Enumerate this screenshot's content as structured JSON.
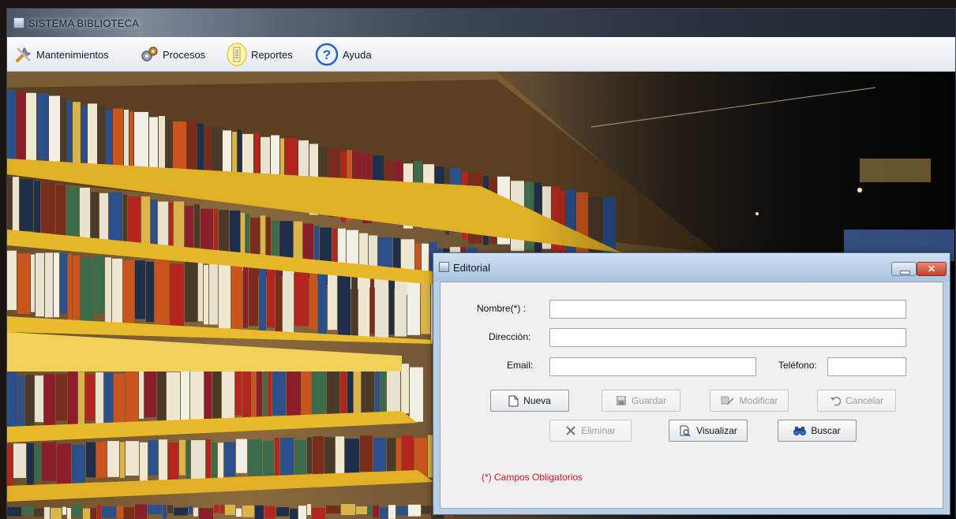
{
  "window": {
    "title": "SISTEMA BIBLIOTECA"
  },
  "menubar": {
    "items": [
      {
        "label": "Mantenimientos",
        "icon": "wrench-icon"
      },
      {
        "label": "Procesos",
        "icon": "gears-icon"
      },
      {
        "label": "Reportes",
        "icon": "report-icon"
      },
      {
        "label": "Ayuda",
        "icon": "help-icon"
      }
    ]
  },
  "dialog": {
    "title": "Editorial",
    "fields": {
      "nombre": {
        "label": "Nombre(*) :",
        "value": ""
      },
      "direccion": {
        "label": "Direcciòn:",
        "value": ""
      },
      "email": {
        "label": "Email:",
        "value": ""
      },
      "telefono": {
        "label": "Teléfono:",
        "value": ""
      }
    },
    "buttons": {
      "nueva": {
        "label": "Nueva",
        "enabled": true
      },
      "guardar": {
        "label": "Guardar",
        "enabled": false
      },
      "modificar": {
        "label": "Modificar",
        "enabled": false
      },
      "cancelar": {
        "label": "Cancelar",
        "enabled": false
      },
      "eliminar": {
        "label": "Eliminar",
        "enabled": false
      },
      "visualizar": {
        "label": "Visualizar",
        "enabled": true
      },
      "buscar": {
        "label": "Buscar",
        "enabled": true
      }
    },
    "required_note": "(*) Campos Obligatorios"
  },
  "colors": {
    "required_note": "#d8102a",
    "close_button": "#c24028",
    "dialog_frame": "#b9cfe6"
  }
}
